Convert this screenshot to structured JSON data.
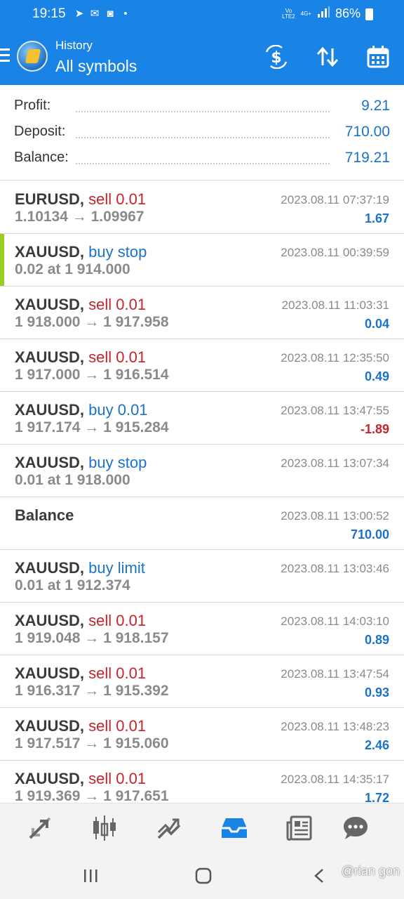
{
  "status_bar": {
    "time": "19:15",
    "network_top": "Vo",
    "network_bottom": "LTE2",
    "net_type": "4G+",
    "battery": "86%"
  },
  "header": {
    "title": "History",
    "subtitle": "All symbols",
    "accent_color": "#1a83e6"
  },
  "summary": [
    {
      "label": "Profit:",
      "value": "9.21"
    },
    {
      "label": "Deposit:",
      "value": "710.00"
    },
    {
      "label": "Balance:",
      "value": "719.21"
    }
  ],
  "deals": [
    {
      "symbol": "EURUSD",
      "type": "sell 0.01",
      "details": "1.10134 → 1.09967",
      "time": "2023.08.11 07:37:19",
      "profit": "1.67"
    },
    {
      "symbol": "XAUUSD",
      "type": "buy stop",
      "details": "0.02 at 1 914.000",
      "time": "2023.08.11 00:39:59",
      "profit": ""
    },
    {
      "symbol": "XAUUSD",
      "type": "sell 0.01",
      "details": "1 918.000 → 1 917.958",
      "time": "2023.08.11 11:03:31",
      "profit": "0.04"
    },
    {
      "symbol": "XAUUSD",
      "type": "sell 0.01",
      "details": "1 917.000 → 1 916.514",
      "time": "2023.08.11 12:35:50",
      "profit": "0.49"
    },
    {
      "symbol": "XAUUSD",
      "type": "buy 0.01",
      "details": "1 917.174 → 1 915.284",
      "time": "2023.08.11 13:47:55",
      "profit": "-1.89"
    },
    {
      "symbol": "XAUUSD",
      "type": "buy stop",
      "details": "0.01 at 1 918.000",
      "time": "2023.08.11 13:07:34",
      "profit": ""
    },
    {
      "symbol": "Balance",
      "type": "",
      "details": "",
      "time": "2023.08.11 13:00:52",
      "profit": "710.00"
    },
    {
      "symbol": "XAUUSD",
      "type": "buy limit",
      "details": "0.01 at 1 912.374",
      "time": "2023.08.11 13:03:46",
      "profit": ""
    },
    {
      "symbol": "XAUUSD",
      "type": "sell 0.01",
      "details": "1 919.048 → 1 918.157",
      "time": "2023.08.11 14:03:10",
      "profit": "0.89"
    },
    {
      "symbol": "XAUUSD",
      "type": "sell 0.01",
      "details": "1 916.317 → 1 915.392",
      "time": "2023.08.11 13:47:54",
      "profit": "0.93"
    },
    {
      "symbol": "XAUUSD",
      "type": "sell 0.01",
      "details": "1 917.517 → 1 915.060",
      "time": "2023.08.11 13:48:23",
      "profit": "2.46"
    },
    {
      "symbol": "XAUUSD",
      "type": "sell 0.01",
      "details": "1 919.369 → 1 917.651",
      "time": "2023.08.11 14:35:17",
      "profit": "1.72"
    }
  ],
  "bottom_nav": [
    "quotes-icon",
    "chart-icon",
    "trade-icon",
    "history-icon",
    "news-icon",
    "chat-icon"
  ],
  "watermark": "@rian gon",
  "colors": {
    "sell": "#c4242c",
    "buy": "#1a73c8",
    "pending_marker": "#9acd1e",
    "active_nav": "#1a83e6"
  }
}
